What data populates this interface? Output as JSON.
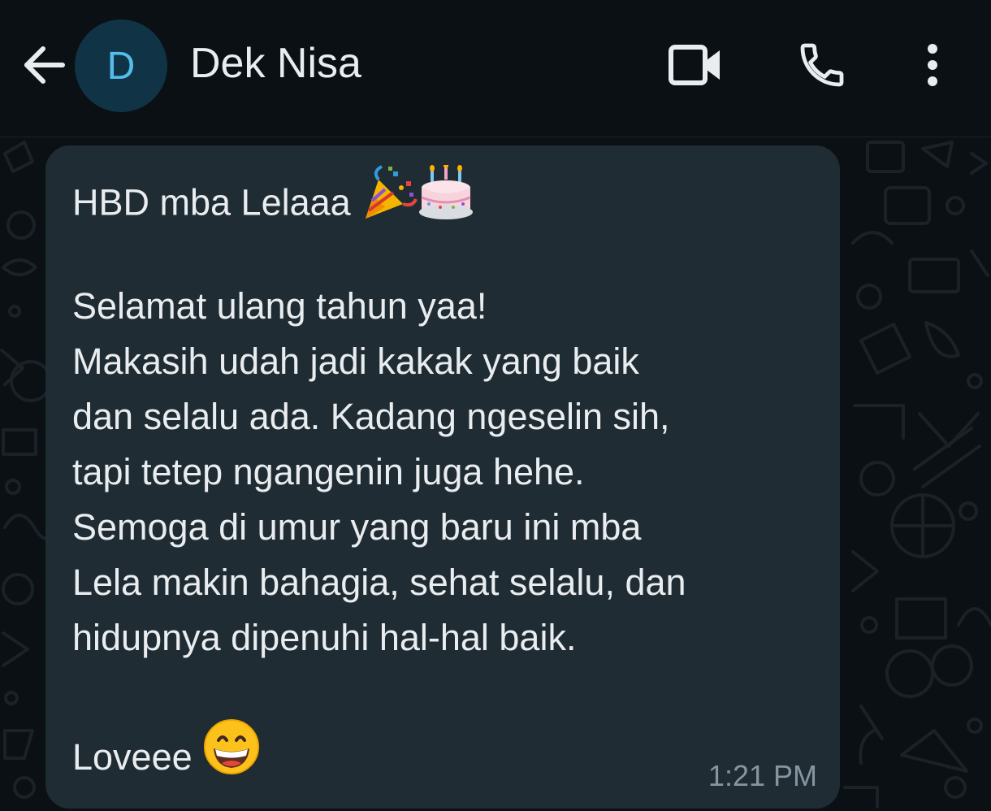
{
  "header": {
    "avatar_initial": "D",
    "contact_name": "Dek Nisa",
    "back_icon": "arrow-left-icon",
    "video_icon": "video-camera-icon",
    "call_icon": "phone-icon",
    "menu_icon": "more-vertical-icon"
  },
  "message": {
    "line1_text": "HBD mba Lelaaa",
    "line1_emojis": [
      "party-popper-icon",
      "birthday-cake-icon"
    ],
    "lines": [
      "Selamat ulang tahun yaa!",
      "Makasih udah jadi kakak yang baik",
      "dan selalu ada. Kadang ngeselin sih,",
      "tapi tetep ngangenin juga hehe.",
      "Semoga di umur yang baru ini mba",
      "Lela makin bahagia, sehat selalu, dan",
      "hidupnya dipenuhi hal-hal baik."
    ],
    "closing_text": "Loveee",
    "closing_emoji": "grinning-face-icon",
    "timestamp": "1:21 PM"
  },
  "colors": {
    "background": "#0b1014",
    "bubble": "#202c33",
    "text": "#e9edef",
    "timestamp": "#8696a0",
    "avatar_bg": "#103446",
    "avatar_text": "#53bdeb",
    "wallpaper_doodle": "#1a2227"
  }
}
